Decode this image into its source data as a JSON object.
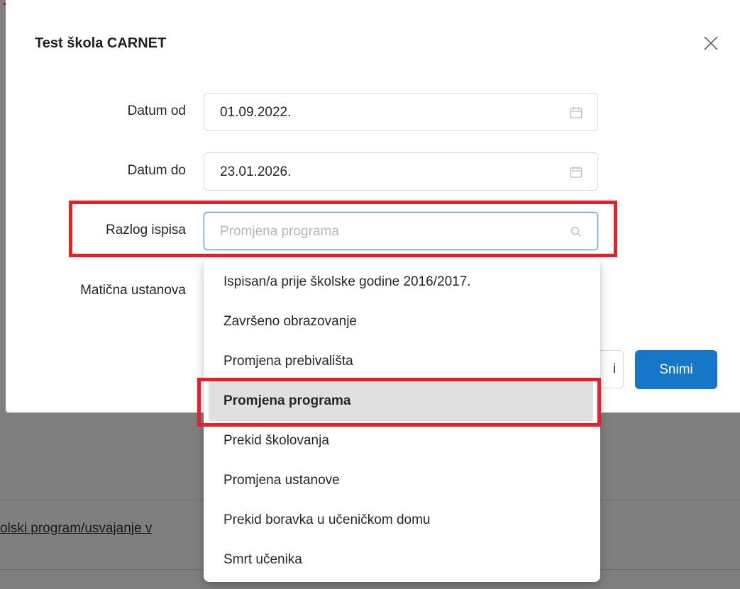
{
  "background": {
    "link_text": "olski program/usvajanje v"
  },
  "modal": {
    "title": "Test škola CARNET",
    "fields": {
      "date_from": {
        "label": "Datum od",
        "value": "01.09.2022."
      },
      "date_to": {
        "label": "Datum do",
        "value": "23.01.2026."
      },
      "reason": {
        "label": "Razlog ispisa",
        "placeholder": "Promjena programa"
      },
      "home_institution": {
        "label": "Matična ustanova"
      }
    },
    "buttons": {
      "cancel_partial": "i",
      "save": "Snimi"
    }
  },
  "dropdown": {
    "options": [
      "Ispisan/a prije školske godine 2016/2017.",
      "Završeno obrazovanje",
      "Promjena prebivališta",
      "Promjena programa",
      "Prekid školovanja",
      "Promjena ustanove",
      "Prekid boravka u učeničkom domu",
      "Smrt učenika"
    ],
    "selected_index": 3
  },
  "colors": {
    "primary": "#1677c9",
    "highlight": "#e8202a",
    "focus_border": "#4a90e2"
  }
}
